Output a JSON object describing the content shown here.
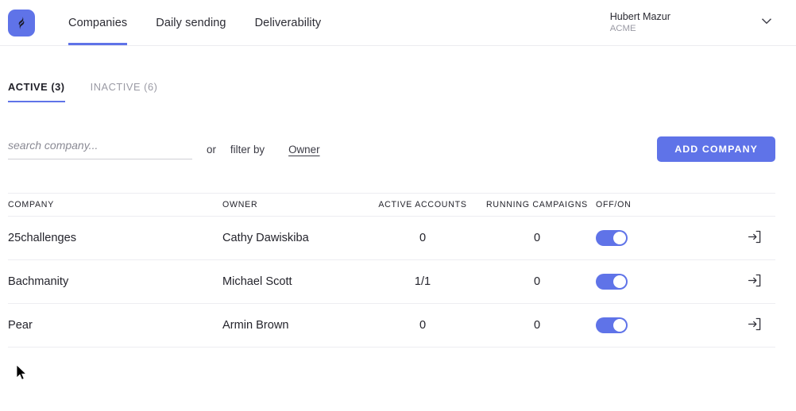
{
  "header": {
    "logo_icon": "brand-swirl-icon",
    "brand_color": "#5f73e8",
    "nav": [
      {
        "label": "Companies",
        "active": true
      },
      {
        "label": "Daily sending",
        "active": false
      },
      {
        "label": "Deliverability",
        "active": false
      }
    ],
    "user": {
      "name": "Hubert Mazur",
      "org": "ACME",
      "caret_icon": "chevron-down-icon"
    }
  },
  "subtabs": [
    {
      "label": "ACTIVE (3)",
      "active": true
    },
    {
      "label": "INACTIVE (6)",
      "active": false
    }
  ],
  "filterbar": {
    "search_placeholder": "search company...",
    "search_value": "",
    "or_label": "or",
    "filter_by_label": "filter by",
    "owner_link": "Owner",
    "add_company_label": "ADD COMPANY"
  },
  "table": {
    "columns": {
      "company": "COMPANY",
      "owner": "OWNER",
      "active_accounts": "ACTIVE ACCOUNTS",
      "running_campaigns": "RUNNING CAMPAIGNS",
      "off_on": "OFF/ON"
    },
    "rows": [
      {
        "company": "25challenges",
        "owner": "Cathy Dawiskiba",
        "active_accounts": "0",
        "running_campaigns": "0",
        "enabled": true,
        "login_icon": "login-icon",
        "expand_icon": "chevron-down-icon"
      },
      {
        "company": "Bachmanity",
        "owner": "Michael Scott",
        "active_accounts": "1/1",
        "running_campaigns": "0",
        "enabled": true,
        "login_icon": "login-icon",
        "expand_icon": "chevron-down-icon"
      },
      {
        "company": "Pear",
        "owner": "Armin Brown",
        "active_accounts": "0",
        "running_campaigns": "0",
        "enabled": true,
        "login_icon": "login-icon",
        "expand_icon": "chevron-down-icon"
      }
    ]
  },
  "cursor": {
    "icon": "mouse-pointer-icon"
  }
}
